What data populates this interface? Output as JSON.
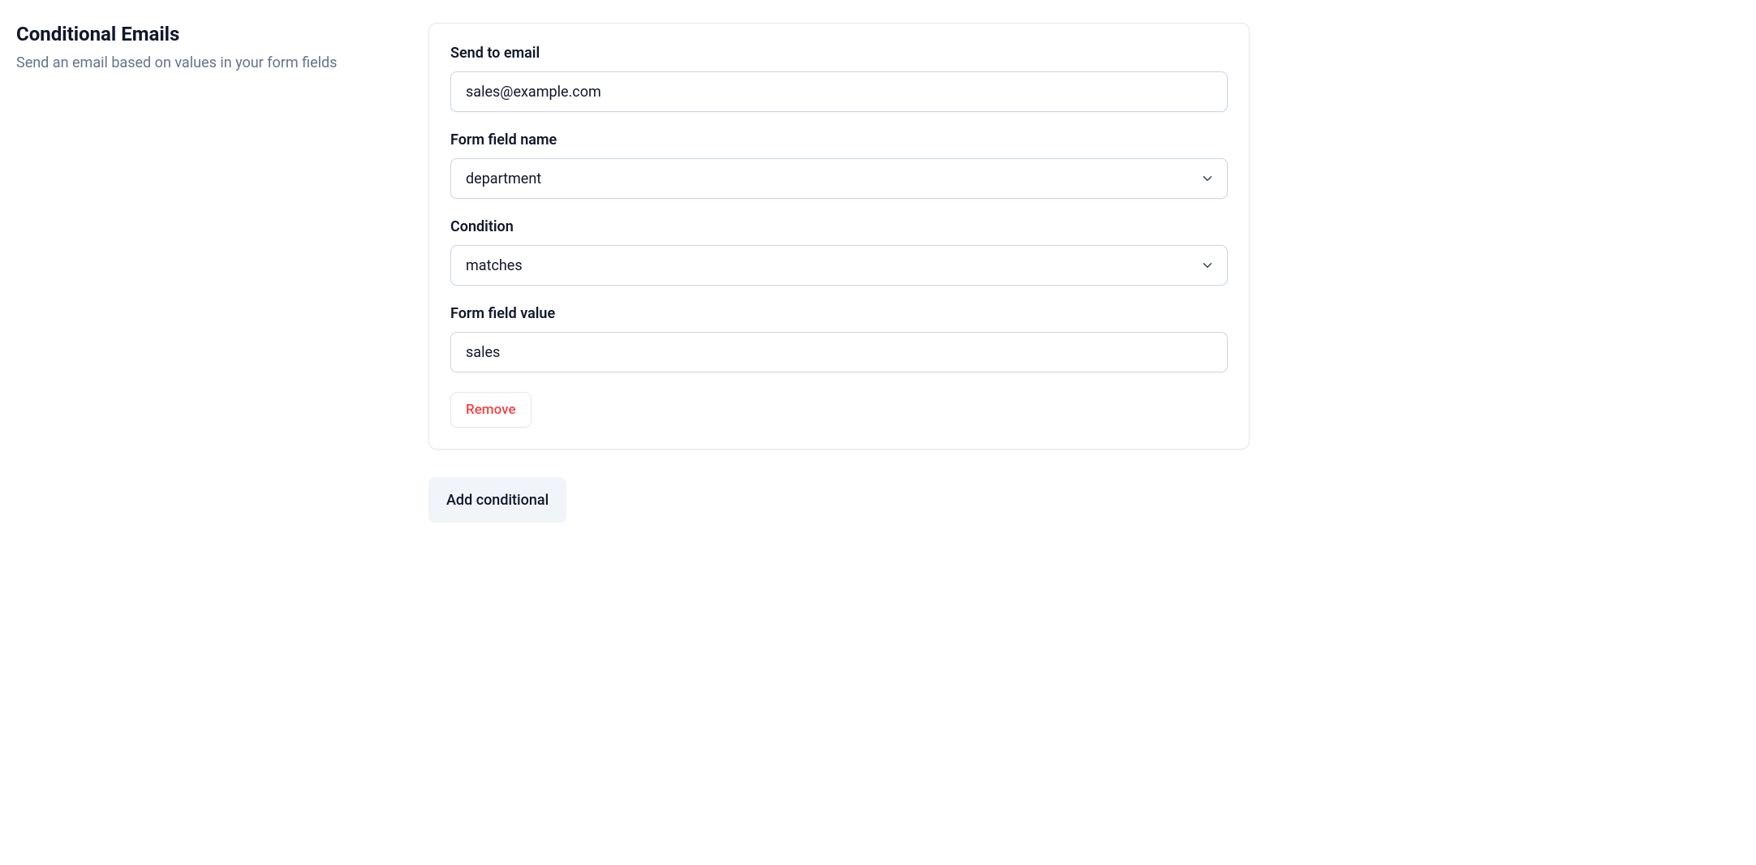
{
  "sidebar": {
    "title": "Conditional Emails",
    "description": "Send an email based on values in your form fields"
  },
  "card": {
    "send_to_email_label": "Send to email",
    "send_to_email_value": "sales@example.com",
    "form_field_name_label": "Form field name",
    "form_field_name_value": "department",
    "condition_label": "Condition",
    "condition_value": "matches",
    "form_field_value_label": "Form field value",
    "form_field_value_value": "sales",
    "remove_label": "Remove"
  },
  "actions": {
    "add_conditional_label": "Add conditional"
  }
}
